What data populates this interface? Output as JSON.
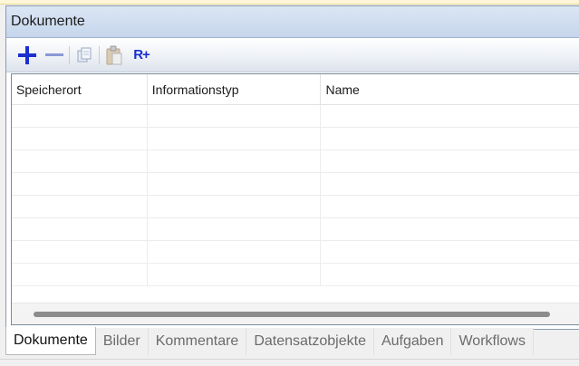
{
  "panel": {
    "title": "Dokumente"
  },
  "toolbar": {
    "buttons": [
      {
        "icon": "plus-icon",
        "label": ""
      },
      {
        "icon": "minus-icon",
        "label": ""
      },
      {
        "icon": "copy-icon",
        "label": ""
      },
      {
        "icon": "paste-icon",
        "label": ""
      },
      {
        "icon": "r-plus-icon",
        "label": "R+"
      }
    ]
  },
  "grid": {
    "columns": [
      "Speicherort",
      "Informationstyp",
      "Name"
    ],
    "rows": [
      [
        "",
        "",
        ""
      ],
      [
        "",
        "",
        ""
      ],
      [
        "",
        "",
        ""
      ],
      [
        "",
        "",
        ""
      ],
      [
        "",
        "",
        ""
      ],
      [
        "",
        "",
        ""
      ],
      [
        "",
        "",
        ""
      ],
      [
        "",
        "",
        ""
      ]
    ]
  },
  "tabs": [
    {
      "label": "Dokumente",
      "active": true
    },
    {
      "label": "Bilder",
      "active": false
    },
    {
      "label": "Kommentare",
      "active": false
    },
    {
      "label": "Datensatzobjekte",
      "active": false
    },
    {
      "label": "Aufgaben",
      "active": false
    },
    {
      "label": "Workflows",
      "active": false
    }
  ],
  "colors": {
    "accent_blue": "#1a2fd0",
    "title_bar": "#c6d6ec",
    "border": "#8a9bb0"
  }
}
